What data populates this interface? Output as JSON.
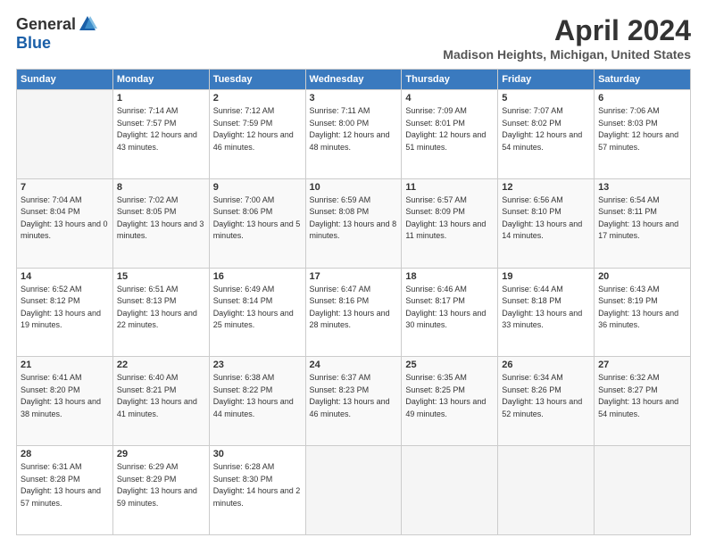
{
  "logo": {
    "general": "General",
    "blue": "Blue"
  },
  "title": "April 2024",
  "location": "Madison Heights, Michigan, United States",
  "days_of_week": [
    "Sunday",
    "Monday",
    "Tuesday",
    "Wednesday",
    "Thursday",
    "Friday",
    "Saturday"
  ],
  "weeks": [
    [
      {
        "day": "",
        "sunrise": "",
        "sunset": "",
        "daylight": ""
      },
      {
        "day": "1",
        "sunrise": "Sunrise: 7:14 AM",
        "sunset": "Sunset: 7:57 PM",
        "daylight": "Daylight: 12 hours and 43 minutes."
      },
      {
        "day": "2",
        "sunrise": "Sunrise: 7:12 AM",
        "sunset": "Sunset: 7:59 PM",
        "daylight": "Daylight: 12 hours and 46 minutes."
      },
      {
        "day": "3",
        "sunrise": "Sunrise: 7:11 AM",
        "sunset": "Sunset: 8:00 PM",
        "daylight": "Daylight: 12 hours and 48 minutes."
      },
      {
        "day": "4",
        "sunrise": "Sunrise: 7:09 AM",
        "sunset": "Sunset: 8:01 PM",
        "daylight": "Daylight: 12 hours and 51 minutes."
      },
      {
        "day": "5",
        "sunrise": "Sunrise: 7:07 AM",
        "sunset": "Sunset: 8:02 PM",
        "daylight": "Daylight: 12 hours and 54 minutes."
      },
      {
        "day": "6",
        "sunrise": "Sunrise: 7:06 AM",
        "sunset": "Sunset: 8:03 PM",
        "daylight": "Daylight: 12 hours and 57 minutes."
      }
    ],
    [
      {
        "day": "7",
        "sunrise": "Sunrise: 7:04 AM",
        "sunset": "Sunset: 8:04 PM",
        "daylight": "Daylight: 13 hours and 0 minutes."
      },
      {
        "day": "8",
        "sunrise": "Sunrise: 7:02 AM",
        "sunset": "Sunset: 8:05 PM",
        "daylight": "Daylight: 13 hours and 3 minutes."
      },
      {
        "day": "9",
        "sunrise": "Sunrise: 7:00 AM",
        "sunset": "Sunset: 8:06 PM",
        "daylight": "Daylight: 13 hours and 5 minutes."
      },
      {
        "day": "10",
        "sunrise": "Sunrise: 6:59 AM",
        "sunset": "Sunset: 8:08 PM",
        "daylight": "Daylight: 13 hours and 8 minutes."
      },
      {
        "day": "11",
        "sunrise": "Sunrise: 6:57 AM",
        "sunset": "Sunset: 8:09 PM",
        "daylight": "Daylight: 13 hours and 11 minutes."
      },
      {
        "day": "12",
        "sunrise": "Sunrise: 6:56 AM",
        "sunset": "Sunset: 8:10 PM",
        "daylight": "Daylight: 13 hours and 14 minutes."
      },
      {
        "day": "13",
        "sunrise": "Sunrise: 6:54 AM",
        "sunset": "Sunset: 8:11 PM",
        "daylight": "Daylight: 13 hours and 17 minutes."
      }
    ],
    [
      {
        "day": "14",
        "sunrise": "Sunrise: 6:52 AM",
        "sunset": "Sunset: 8:12 PM",
        "daylight": "Daylight: 13 hours and 19 minutes."
      },
      {
        "day": "15",
        "sunrise": "Sunrise: 6:51 AM",
        "sunset": "Sunset: 8:13 PM",
        "daylight": "Daylight: 13 hours and 22 minutes."
      },
      {
        "day": "16",
        "sunrise": "Sunrise: 6:49 AM",
        "sunset": "Sunset: 8:14 PM",
        "daylight": "Daylight: 13 hours and 25 minutes."
      },
      {
        "day": "17",
        "sunrise": "Sunrise: 6:47 AM",
        "sunset": "Sunset: 8:16 PM",
        "daylight": "Daylight: 13 hours and 28 minutes."
      },
      {
        "day": "18",
        "sunrise": "Sunrise: 6:46 AM",
        "sunset": "Sunset: 8:17 PM",
        "daylight": "Daylight: 13 hours and 30 minutes."
      },
      {
        "day": "19",
        "sunrise": "Sunrise: 6:44 AM",
        "sunset": "Sunset: 8:18 PM",
        "daylight": "Daylight: 13 hours and 33 minutes."
      },
      {
        "day": "20",
        "sunrise": "Sunrise: 6:43 AM",
        "sunset": "Sunset: 8:19 PM",
        "daylight": "Daylight: 13 hours and 36 minutes."
      }
    ],
    [
      {
        "day": "21",
        "sunrise": "Sunrise: 6:41 AM",
        "sunset": "Sunset: 8:20 PM",
        "daylight": "Daylight: 13 hours and 38 minutes."
      },
      {
        "day": "22",
        "sunrise": "Sunrise: 6:40 AM",
        "sunset": "Sunset: 8:21 PM",
        "daylight": "Daylight: 13 hours and 41 minutes."
      },
      {
        "day": "23",
        "sunrise": "Sunrise: 6:38 AM",
        "sunset": "Sunset: 8:22 PM",
        "daylight": "Daylight: 13 hours and 44 minutes."
      },
      {
        "day": "24",
        "sunrise": "Sunrise: 6:37 AM",
        "sunset": "Sunset: 8:23 PM",
        "daylight": "Daylight: 13 hours and 46 minutes."
      },
      {
        "day": "25",
        "sunrise": "Sunrise: 6:35 AM",
        "sunset": "Sunset: 8:25 PM",
        "daylight": "Daylight: 13 hours and 49 minutes."
      },
      {
        "day": "26",
        "sunrise": "Sunrise: 6:34 AM",
        "sunset": "Sunset: 8:26 PM",
        "daylight": "Daylight: 13 hours and 52 minutes."
      },
      {
        "day": "27",
        "sunrise": "Sunrise: 6:32 AM",
        "sunset": "Sunset: 8:27 PM",
        "daylight": "Daylight: 13 hours and 54 minutes."
      }
    ],
    [
      {
        "day": "28",
        "sunrise": "Sunrise: 6:31 AM",
        "sunset": "Sunset: 8:28 PM",
        "daylight": "Daylight: 13 hours and 57 minutes."
      },
      {
        "day": "29",
        "sunrise": "Sunrise: 6:29 AM",
        "sunset": "Sunset: 8:29 PM",
        "daylight": "Daylight: 13 hours and 59 minutes."
      },
      {
        "day": "30",
        "sunrise": "Sunrise: 6:28 AM",
        "sunset": "Sunset: 8:30 PM",
        "daylight": "Daylight: 14 hours and 2 minutes."
      },
      {
        "day": "",
        "sunrise": "",
        "sunset": "",
        "daylight": ""
      },
      {
        "day": "",
        "sunrise": "",
        "sunset": "",
        "daylight": ""
      },
      {
        "day": "",
        "sunrise": "",
        "sunset": "",
        "daylight": ""
      },
      {
        "day": "",
        "sunrise": "",
        "sunset": "",
        "daylight": ""
      }
    ]
  ]
}
